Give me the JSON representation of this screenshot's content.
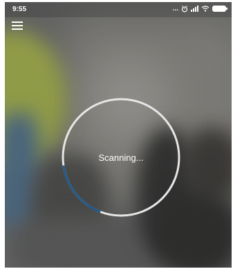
{
  "status_bar": {
    "time": "9:55",
    "overflow": "...",
    "icons": [
      "alarm-icon",
      "signal-icon",
      "wifi-icon",
      "battery-icon"
    ]
  },
  "menu": {
    "icon": "hamburger-menu-icon"
  },
  "scanner": {
    "label": "Scanning...",
    "progress": 0.17,
    "ring_color": "#e6e6e6",
    "progress_color": "#1f5a8c"
  }
}
